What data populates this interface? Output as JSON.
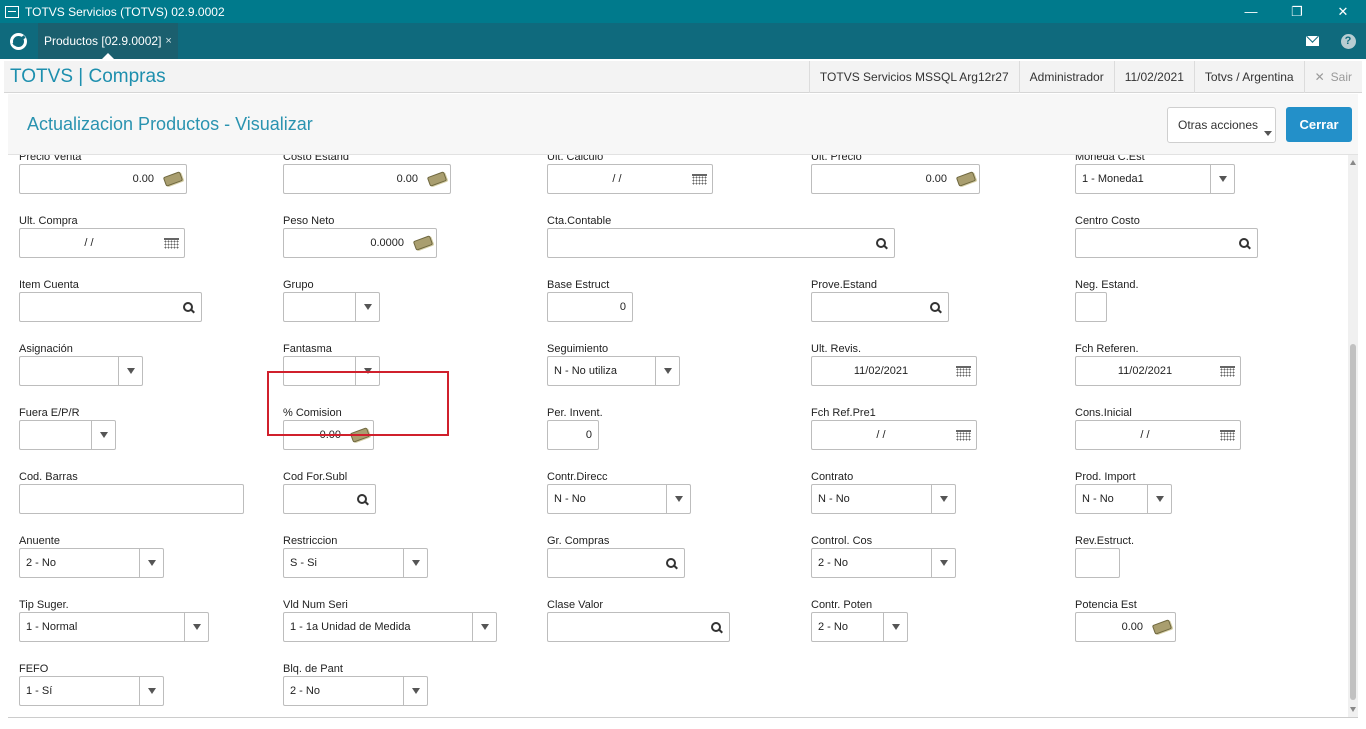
{
  "window": {
    "title": "TOTVS Servicios (TOTVS) 02.9.0002",
    "minimize": "—",
    "restore": "❐",
    "close": "✕"
  },
  "tabbar": {
    "tab_label": "Productos [02.9.0002]",
    "tab_close": "×",
    "help": "?"
  },
  "header": {
    "brand": "TOTVS | Compras",
    "environment": "TOTVS Servicios MSSQL Arg12r27",
    "user": "Administrador",
    "date": "11/02/2021",
    "company": "Totvs / Argentina",
    "exit_icon": "✕",
    "exit_label": "Sair"
  },
  "page": {
    "title": "Actualizacion Productos - Visualizar",
    "otras_acciones": "Otras acciones",
    "cerrar": "Cerrar"
  },
  "fields": {
    "precio_venta": {
      "label": "Precio Venta",
      "value": "0.00"
    },
    "costo_estand": {
      "label": "Costo Estand",
      "value": "0.00"
    },
    "ult_calculo": {
      "label": "Ult. Calculo",
      "value": "/ /"
    },
    "ult_precio": {
      "label": "Ult. Precio",
      "value": "0.00"
    },
    "moneda_cest": {
      "label": "Moneda C.Est",
      "value": "1 - Moneda1"
    },
    "ult_compra": {
      "label": "Ult. Compra",
      "value": "/ /"
    },
    "peso_neto": {
      "label": "Peso Neto",
      "value": "0.0000"
    },
    "cta_contable": {
      "label": "Cta.Contable",
      "value": ""
    },
    "centro_costo": {
      "label": "Centro Costo",
      "value": ""
    },
    "item_cuenta": {
      "label": "Item Cuenta",
      "value": ""
    },
    "grupo": {
      "label": "Grupo",
      "value": ""
    },
    "base_estruct": {
      "label": "Base Estruct",
      "value": "0"
    },
    "prove_estand": {
      "label": "Prove.Estand",
      "value": ""
    },
    "neg_estand": {
      "label": "Neg. Estand.",
      "value": ""
    },
    "asignacion": {
      "label": "Asignación",
      "value": ""
    },
    "fantasma": {
      "label": "Fantasma",
      "value": ""
    },
    "seguimiento": {
      "label": "Seguimiento",
      "value": "N - No utiliza"
    },
    "ult_revis": {
      "label": "Ult. Revis.",
      "value": "11/02/2021"
    },
    "fch_referen": {
      "label": "Fch Referen.",
      "value": "11/02/2021"
    },
    "fuera_epr": {
      "label": "Fuera E/P/R",
      "value": ""
    },
    "comision": {
      "label": "% Comision",
      "value": "0.00"
    },
    "per_invent": {
      "label": "Per. Invent.",
      "value": "0"
    },
    "fch_ref_pre1": {
      "label": "Fch Ref.Pre1",
      "value": "/ /"
    },
    "cons_inicial": {
      "label": "Cons.Inicial",
      "value": "/ /"
    },
    "cod_barras": {
      "label": "Cod. Barras",
      "value": ""
    },
    "cod_for_subl": {
      "label": "Cod For.Subl",
      "value": ""
    },
    "contr_direcc": {
      "label": "Contr.Direcc",
      "value": "N - No"
    },
    "contrato": {
      "label": "Contrato",
      "value": "N - No"
    },
    "prod_import": {
      "label": "Prod. Import",
      "value": "N - No"
    },
    "anuente": {
      "label": "Anuente",
      "value": "2 - No"
    },
    "restriccion": {
      "label": "Restriccion",
      "value": "S - Si"
    },
    "gr_compras": {
      "label": "Gr. Compras",
      "value": ""
    },
    "control_cos": {
      "label": "Control. Cos",
      "value": "2 - No"
    },
    "rev_estruct": {
      "label": "Rev.Estruct.",
      "value": ""
    },
    "tip_suger": {
      "label": "Tip Suger.",
      "value": "1 - Normal"
    },
    "vld_num_seri": {
      "label": "Vld Num Seri",
      "value": "1 - 1a Unidad de Medida"
    },
    "clase_valor": {
      "label": "Clase Valor",
      "value": ""
    },
    "contr_poten": {
      "label": "Contr. Poten",
      "value": "2 - No"
    },
    "potencia_est": {
      "label": "Potencia Est",
      "value": "0.00"
    },
    "fefo": {
      "label": "FEFO",
      "value": "1 - Sí"
    },
    "blq_de_pant": {
      "label": "Blq. de Pant",
      "value": "2 - No"
    }
  }
}
